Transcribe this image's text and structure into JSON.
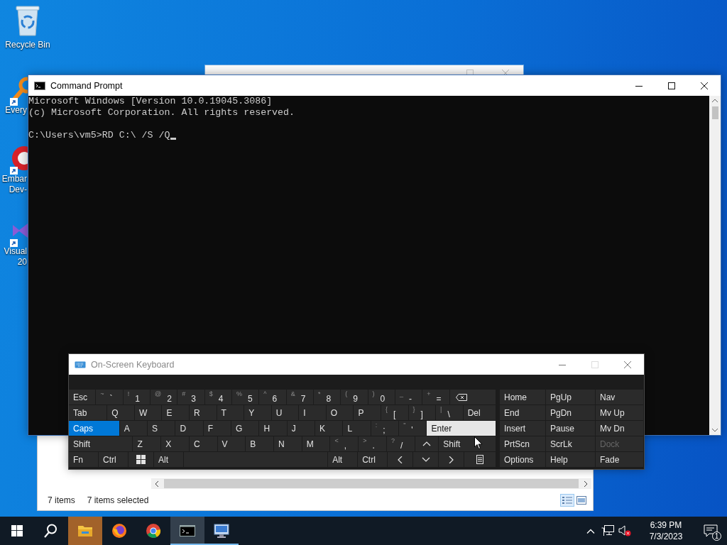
{
  "desktop": {
    "icons": [
      {
        "kind": "recycle",
        "label_lines": [
          "Recycle Bin"
        ]
      },
      {
        "kind": "search-app",
        "label_lines": [
          "Every"
        ]
      },
      {
        "kind": "red-app",
        "label_lines": [
          "Embar",
          "Dev-"
        ]
      },
      {
        "kind": "purple-app",
        "label_lines": [
          "Visual",
          "20"
        ]
      }
    ]
  },
  "explorer": {
    "status_count": "7 items",
    "status_selected": "7 items selected"
  },
  "cmd": {
    "title": "Command Prompt",
    "output": [
      "Microsoft Windows [Version 10.0.19045.3086]",
      "(c) Microsoft Corporation. All rights reserved."
    ],
    "input_line": "C:\\Users\\vm5>RD C:\\ /S /Q"
  },
  "keyboard": {
    "title": "On-Screen Keyboard",
    "rows": [
      {
        "keys": [
          {
            "kind": "text",
            "label": "Esc",
            "on": false,
            "hover": false
          },
          {
            "kind": "pair",
            "shift": "~",
            "label": "`",
            "on": false,
            "hover": false
          },
          {
            "kind": "pair",
            "shift": "!",
            "label": "1",
            "on": false,
            "hover": false
          },
          {
            "kind": "pair",
            "shift": "@",
            "label": "2",
            "on": false,
            "hover": false
          },
          {
            "kind": "pair",
            "shift": "#",
            "label": "3",
            "on": false,
            "hover": false
          },
          {
            "kind": "pair",
            "shift": "$",
            "label": "4",
            "on": false,
            "hover": false
          },
          {
            "kind": "pair",
            "shift": "%",
            "label": "5",
            "on": false,
            "hover": false
          },
          {
            "kind": "pair",
            "shift": "^",
            "label": "6",
            "on": false,
            "hover": false
          },
          {
            "kind": "pair",
            "shift": "&",
            "label": "7",
            "on": false,
            "hover": false
          },
          {
            "kind": "pair",
            "shift": "*",
            "label": "8",
            "on": false,
            "hover": false
          },
          {
            "kind": "pair",
            "shift": "(",
            "label": "9",
            "on": false,
            "hover": false
          },
          {
            "kind": "pair",
            "shift": ")",
            "label": "0",
            "on": false,
            "hover": false
          },
          {
            "kind": "pair",
            "shift": "_",
            "label": "-",
            "on": false,
            "hover": false
          },
          {
            "kind": "pair",
            "shift": "+",
            "label": "=",
            "on": false,
            "hover": false
          },
          {
            "kind": "backspace",
            "on": false,
            "hover": false
          }
        ]
      },
      {
        "keys": [
          {
            "kind": "text",
            "label": "Tab",
            "on": false,
            "hover": false
          },
          {
            "kind": "text",
            "label": "Q",
            "on": false,
            "hover": false
          },
          {
            "kind": "text",
            "label": "W",
            "on": false,
            "hover": false
          },
          {
            "kind": "text",
            "label": "E",
            "on": false,
            "hover": false
          },
          {
            "kind": "text",
            "label": "R",
            "on": false,
            "hover": false
          },
          {
            "kind": "text",
            "label": "T",
            "on": false,
            "hover": false
          },
          {
            "kind": "text",
            "label": "Y",
            "on": false,
            "hover": false
          },
          {
            "kind": "text",
            "label": "U",
            "on": false,
            "hover": false
          },
          {
            "kind": "text",
            "label": "I",
            "on": false,
            "hover": false
          },
          {
            "kind": "text",
            "label": "O",
            "on": false,
            "hover": false
          },
          {
            "kind": "text",
            "label": "P",
            "on": false,
            "hover": false
          },
          {
            "kind": "pair",
            "shift": "{",
            "label": "[",
            "on": false,
            "hover": false
          },
          {
            "kind": "pair",
            "shift": "}",
            "label": "]",
            "on": false,
            "hover": false
          },
          {
            "kind": "pair",
            "shift": "|",
            "label": "\\",
            "on": false,
            "hover": false
          },
          {
            "kind": "text",
            "label": "Del",
            "on": false,
            "hover": false
          }
        ]
      },
      {
        "keys": [
          {
            "kind": "text",
            "label": "Caps",
            "on": true,
            "hover": false
          },
          {
            "kind": "text",
            "label": "A",
            "on": false,
            "hover": false
          },
          {
            "kind": "text",
            "label": "S",
            "on": false,
            "hover": false
          },
          {
            "kind": "text",
            "label": "D",
            "on": false,
            "hover": false
          },
          {
            "kind": "text",
            "label": "F",
            "on": false,
            "hover": false
          },
          {
            "kind": "text",
            "label": "G",
            "on": false,
            "hover": false
          },
          {
            "kind": "text",
            "label": "H",
            "on": false,
            "hover": false
          },
          {
            "kind": "text",
            "label": "J",
            "on": false,
            "hover": false
          },
          {
            "kind": "text",
            "label": "K",
            "on": false,
            "hover": false
          },
          {
            "kind": "text",
            "label": "L",
            "on": false,
            "hover": false
          },
          {
            "kind": "pair",
            "shift": ":",
            "label": ";",
            "on": false,
            "hover": false
          },
          {
            "kind": "pair",
            "shift": "\"",
            "label": "'",
            "on": false,
            "hover": false
          },
          {
            "kind": "text",
            "label": "Enter",
            "on": false,
            "hover": true
          }
        ]
      },
      {
        "keys": [
          {
            "kind": "text",
            "label": "Shift",
            "on": false,
            "hover": false
          },
          {
            "kind": "text",
            "label": "Z",
            "on": false,
            "hover": false
          },
          {
            "kind": "text",
            "label": "X",
            "on": false,
            "hover": false
          },
          {
            "kind": "text",
            "label": "C",
            "on": false,
            "hover": false
          },
          {
            "kind": "text",
            "label": "V",
            "on": false,
            "hover": false
          },
          {
            "kind": "text",
            "label": "B",
            "on": false,
            "hover": false
          },
          {
            "kind": "text",
            "label": "N",
            "on": false,
            "hover": false
          },
          {
            "kind": "text",
            "label": "M",
            "on": false,
            "hover": false
          },
          {
            "kind": "pair",
            "shift": "<",
            "label": ",",
            "on": false,
            "hover": false
          },
          {
            "kind": "pair",
            "shift": ">",
            "label": ".",
            "on": false,
            "hover": false
          },
          {
            "kind": "pair",
            "shift": "?",
            "label": "/",
            "on": false,
            "hover": false
          },
          {
            "kind": "up",
            "on": false,
            "hover": false
          },
          {
            "kind": "text",
            "label": "Shift",
            "on": false,
            "hover": false
          }
        ]
      },
      {
        "keys": [
          {
            "kind": "text",
            "label": "Fn",
            "on": false,
            "hover": false
          },
          {
            "kind": "text",
            "label": "Ctrl",
            "on": false,
            "hover": false
          },
          {
            "kind": "windows",
            "on": false,
            "hover": false
          },
          {
            "kind": "text",
            "label": "Alt",
            "on": false,
            "hover": false
          },
          {
            "kind": "space",
            "on": false,
            "hover": false
          },
          {
            "kind": "text",
            "label": "Alt",
            "on": false,
            "hover": false
          },
          {
            "kind": "text",
            "label": "Ctrl",
            "on": false,
            "hover": false
          },
          {
            "kind": "left",
            "on": false,
            "hover": false
          },
          {
            "kind": "down",
            "on": false,
            "hover": false
          },
          {
            "kind": "right",
            "on": false,
            "hover": false
          },
          {
            "kind": "menu",
            "on": false,
            "hover": false
          }
        ]
      }
    ],
    "side_keys": [
      {
        "label": "Home",
        "disabled": false
      },
      {
        "label": "PgUp",
        "disabled": false
      },
      {
        "label": "Nav",
        "disabled": false
      },
      {
        "label": "End",
        "disabled": false
      },
      {
        "label": "PgDn",
        "disabled": false
      },
      {
        "label": "Mv Up",
        "disabled": false
      },
      {
        "label": "Insert",
        "disabled": false
      },
      {
        "label": "Pause",
        "disabled": false
      },
      {
        "label": "Mv Dn",
        "disabled": false
      },
      {
        "label": "PrtScn",
        "disabled": false
      },
      {
        "label": "ScrLk",
        "disabled": false
      },
      {
        "label": "Dock",
        "disabled": true
      },
      {
        "label": "Options",
        "disabled": false
      },
      {
        "label": "Help",
        "disabled": false
      },
      {
        "label": "Fade",
        "disabled": false
      }
    ]
  },
  "taskbar": {
    "apps": [
      {
        "kind": "start",
        "flashing": false,
        "running": false,
        "active": false
      },
      {
        "kind": "search",
        "flashing": false,
        "running": false,
        "active": false
      },
      {
        "kind": "explorer",
        "flashing": true,
        "running": false,
        "active": false
      },
      {
        "kind": "firefox",
        "flashing": false,
        "running": false,
        "active": false
      },
      {
        "kind": "chrome",
        "flashing": false,
        "running": false,
        "active": false
      },
      {
        "kind": "cmd",
        "flashing": false,
        "running": true,
        "active": true
      },
      {
        "kind": "remote",
        "flashing": false,
        "running": true,
        "active": false
      }
    ],
    "volume_muted": true,
    "time": "6:39 PM",
    "date": "7/3/2023",
    "notifications": "1"
  }
}
